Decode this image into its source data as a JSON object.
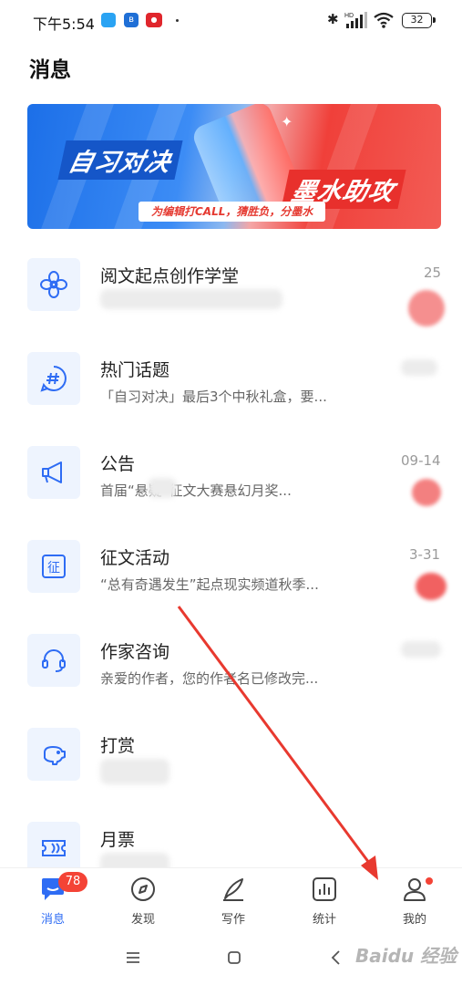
{
  "status_bar": {
    "time": "下午5:54",
    "battery": "32"
  },
  "page": {
    "title": "消息"
  },
  "banner": {
    "left_text": "自习对决",
    "right_text": "墨水助攻",
    "subtitle": "为编辑打CALL，猜胜负，分墨水"
  },
  "messages": [
    {
      "title": "阅文起点创作学堂",
      "preview": "",
      "date": "25",
      "icon": "flower-icon"
    },
    {
      "title": "热门话题",
      "preview": "「自习对决」最后3个中秋礼盒，要...",
      "date": "",
      "icon": "hashtag-icon"
    },
    {
      "title": "公告",
      "preview": "首届“悬疑”征文大赛悬幻月奖...",
      "date": "09-14",
      "icon": "megaphone-icon"
    },
    {
      "title": "征文活动",
      "preview": "“总有奇遇发生”起点现实频道秋季...",
      "date": "3-31",
      "icon": "contest-icon"
    },
    {
      "title": "作家咨询",
      "preview": "亲爱的作者，您的作者名已修改完...",
      "date": "",
      "icon": "headset-icon"
    },
    {
      "title": "打赏",
      "preview": "",
      "date": "",
      "icon": "piggy-bank-icon"
    },
    {
      "title": "月票",
      "preview": "",
      "date": "",
      "icon": "ticket-icon"
    }
  ],
  "nav": {
    "items": [
      {
        "label": "消息",
        "icon": "chat-icon",
        "badge": "78",
        "active": true
      },
      {
        "label": "发现",
        "icon": "compass-icon"
      },
      {
        "label": "写作",
        "icon": "pen-icon"
      },
      {
        "label": "统计",
        "icon": "chart-icon"
      },
      {
        "label": "我的",
        "icon": "profile-icon",
        "dot": true
      }
    ]
  },
  "colors": {
    "accent": "#2e6cf4",
    "badge": "#f44336",
    "annotation_arrow": "#e8392f"
  }
}
